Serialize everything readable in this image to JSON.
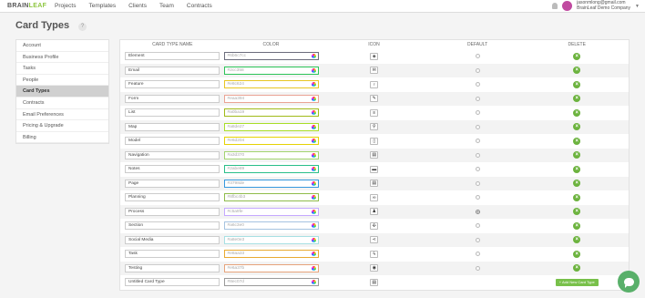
{
  "brand": {
    "brain": "BRAIN",
    "leaf": "LEAF"
  },
  "nav": [
    "Projects",
    "Templates",
    "Clients",
    "Team",
    "Contracts"
  ],
  "user": {
    "email": "jasonmlong@gmail.com",
    "company": "BrainLeaf Demo Company"
  },
  "page_title": "Card Types",
  "help": "?",
  "sidebar": [
    {
      "label": "Account"
    },
    {
      "label": "Business Profile"
    },
    {
      "label": "Tasks"
    },
    {
      "label": "People"
    },
    {
      "label": "Card Types",
      "active": true
    },
    {
      "label": "Contracts"
    },
    {
      "label": "Email Preferences"
    },
    {
      "label": "Pricing & Upgrade"
    },
    {
      "label": "Billing"
    }
  ],
  "table": {
    "headers": [
      "CARD TYPE NAME",
      "COLOR",
      "ICON",
      "DEFAULT",
      "DELETE"
    ],
    "rows": [
      {
        "name": "Element",
        "color": "#6b6c7cc",
        "border": "#6b6c7c",
        "icon": "cube-icon",
        "glyph": "◈",
        "default": false
      },
      {
        "name": "Email",
        "color": "#2cc358",
        "border": "#2cc358",
        "icon": "envelope-icon",
        "glyph": "✉",
        "default": false
      },
      {
        "name": "Feature",
        "color": "#e8c624",
        "border": "#e8c624",
        "icon": "lightbulb-icon",
        "glyph": "♀",
        "default": false
      },
      {
        "name": "Form",
        "color": "#eaa394",
        "border": "#eaa394",
        "icon": "edit-icon",
        "glyph": "✎",
        "default": false
      },
      {
        "name": "List",
        "color": "#a0ba19",
        "border": "#a0ba19",
        "icon": "list-icon",
        "glyph": "≡",
        "default": false
      },
      {
        "name": "Map",
        "color": "#a8de27",
        "border": "#a8de27",
        "icon": "map-marker-icon",
        "glyph": "⚲",
        "default": false
      },
      {
        "name": "Model",
        "color": "#e6d204",
        "border": "#e6d204",
        "icon": "tablet-icon",
        "glyph": "▯",
        "default": false
      },
      {
        "name": "Navigation",
        "color": "#a3d370",
        "border": "#a3d370",
        "icon": "navigation-icon",
        "glyph": "▤",
        "default": false
      },
      {
        "name": "Notes",
        "color": "#2abe89",
        "border": "#2abe89",
        "icon": "notes-icon",
        "glyph": "▬",
        "default": false
      },
      {
        "name": "Page",
        "color": "#3798de",
        "border": "#3798de",
        "icon": "page-icon",
        "glyph": "▤",
        "default": false
      },
      {
        "name": "Planning",
        "color": "#8fbc4b3",
        "border": "#8fbc4b",
        "icon": "binoculars-icon",
        "glyph": "∞",
        "default": false
      },
      {
        "name": "Process",
        "color": "#c5a9fe",
        "border": "#c5a9fe",
        "icon": "person-icon",
        "glyph": "♟",
        "default": true
      },
      {
        "name": "Section",
        "color": "#a6c3e0",
        "border": "#a6c3e0",
        "icon": "puzzle-icon",
        "glyph": "✣",
        "default": false
      },
      {
        "name": "Social Media",
        "color": "#a8e0e3",
        "border": "#a8e0e3",
        "icon": "share-icon",
        "glyph": "⋖",
        "default": false
      },
      {
        "name": "Task",
        "color": "#e8aa33",
        "border": "#e8aa33",
        "icon": "lightning-icon",
        "glyph": "ϟ",
        "default": false
      },
      {
        "name": "Testing",
        "color": "#e6a37b",
        "border": "#e6a37b",
        "icon": "eye-icon",
        "glyph": "◉",
        "default": false
      },
      {
        "name": "Untitled Card Type",
        "color": "#8ec07d",
        "border": "#999999",
        "icon": "document-icon",
        "glyph": "▤",
        "default": null,
        "new_row": true
      }
    ]
  },
  "add_button": "+ Add New Card Type",
  "colors": {
    "accent": "#6cb33e",
    "chat": "#59b06a",
    "brand_leaf": "#8dc63f"
  }
}
